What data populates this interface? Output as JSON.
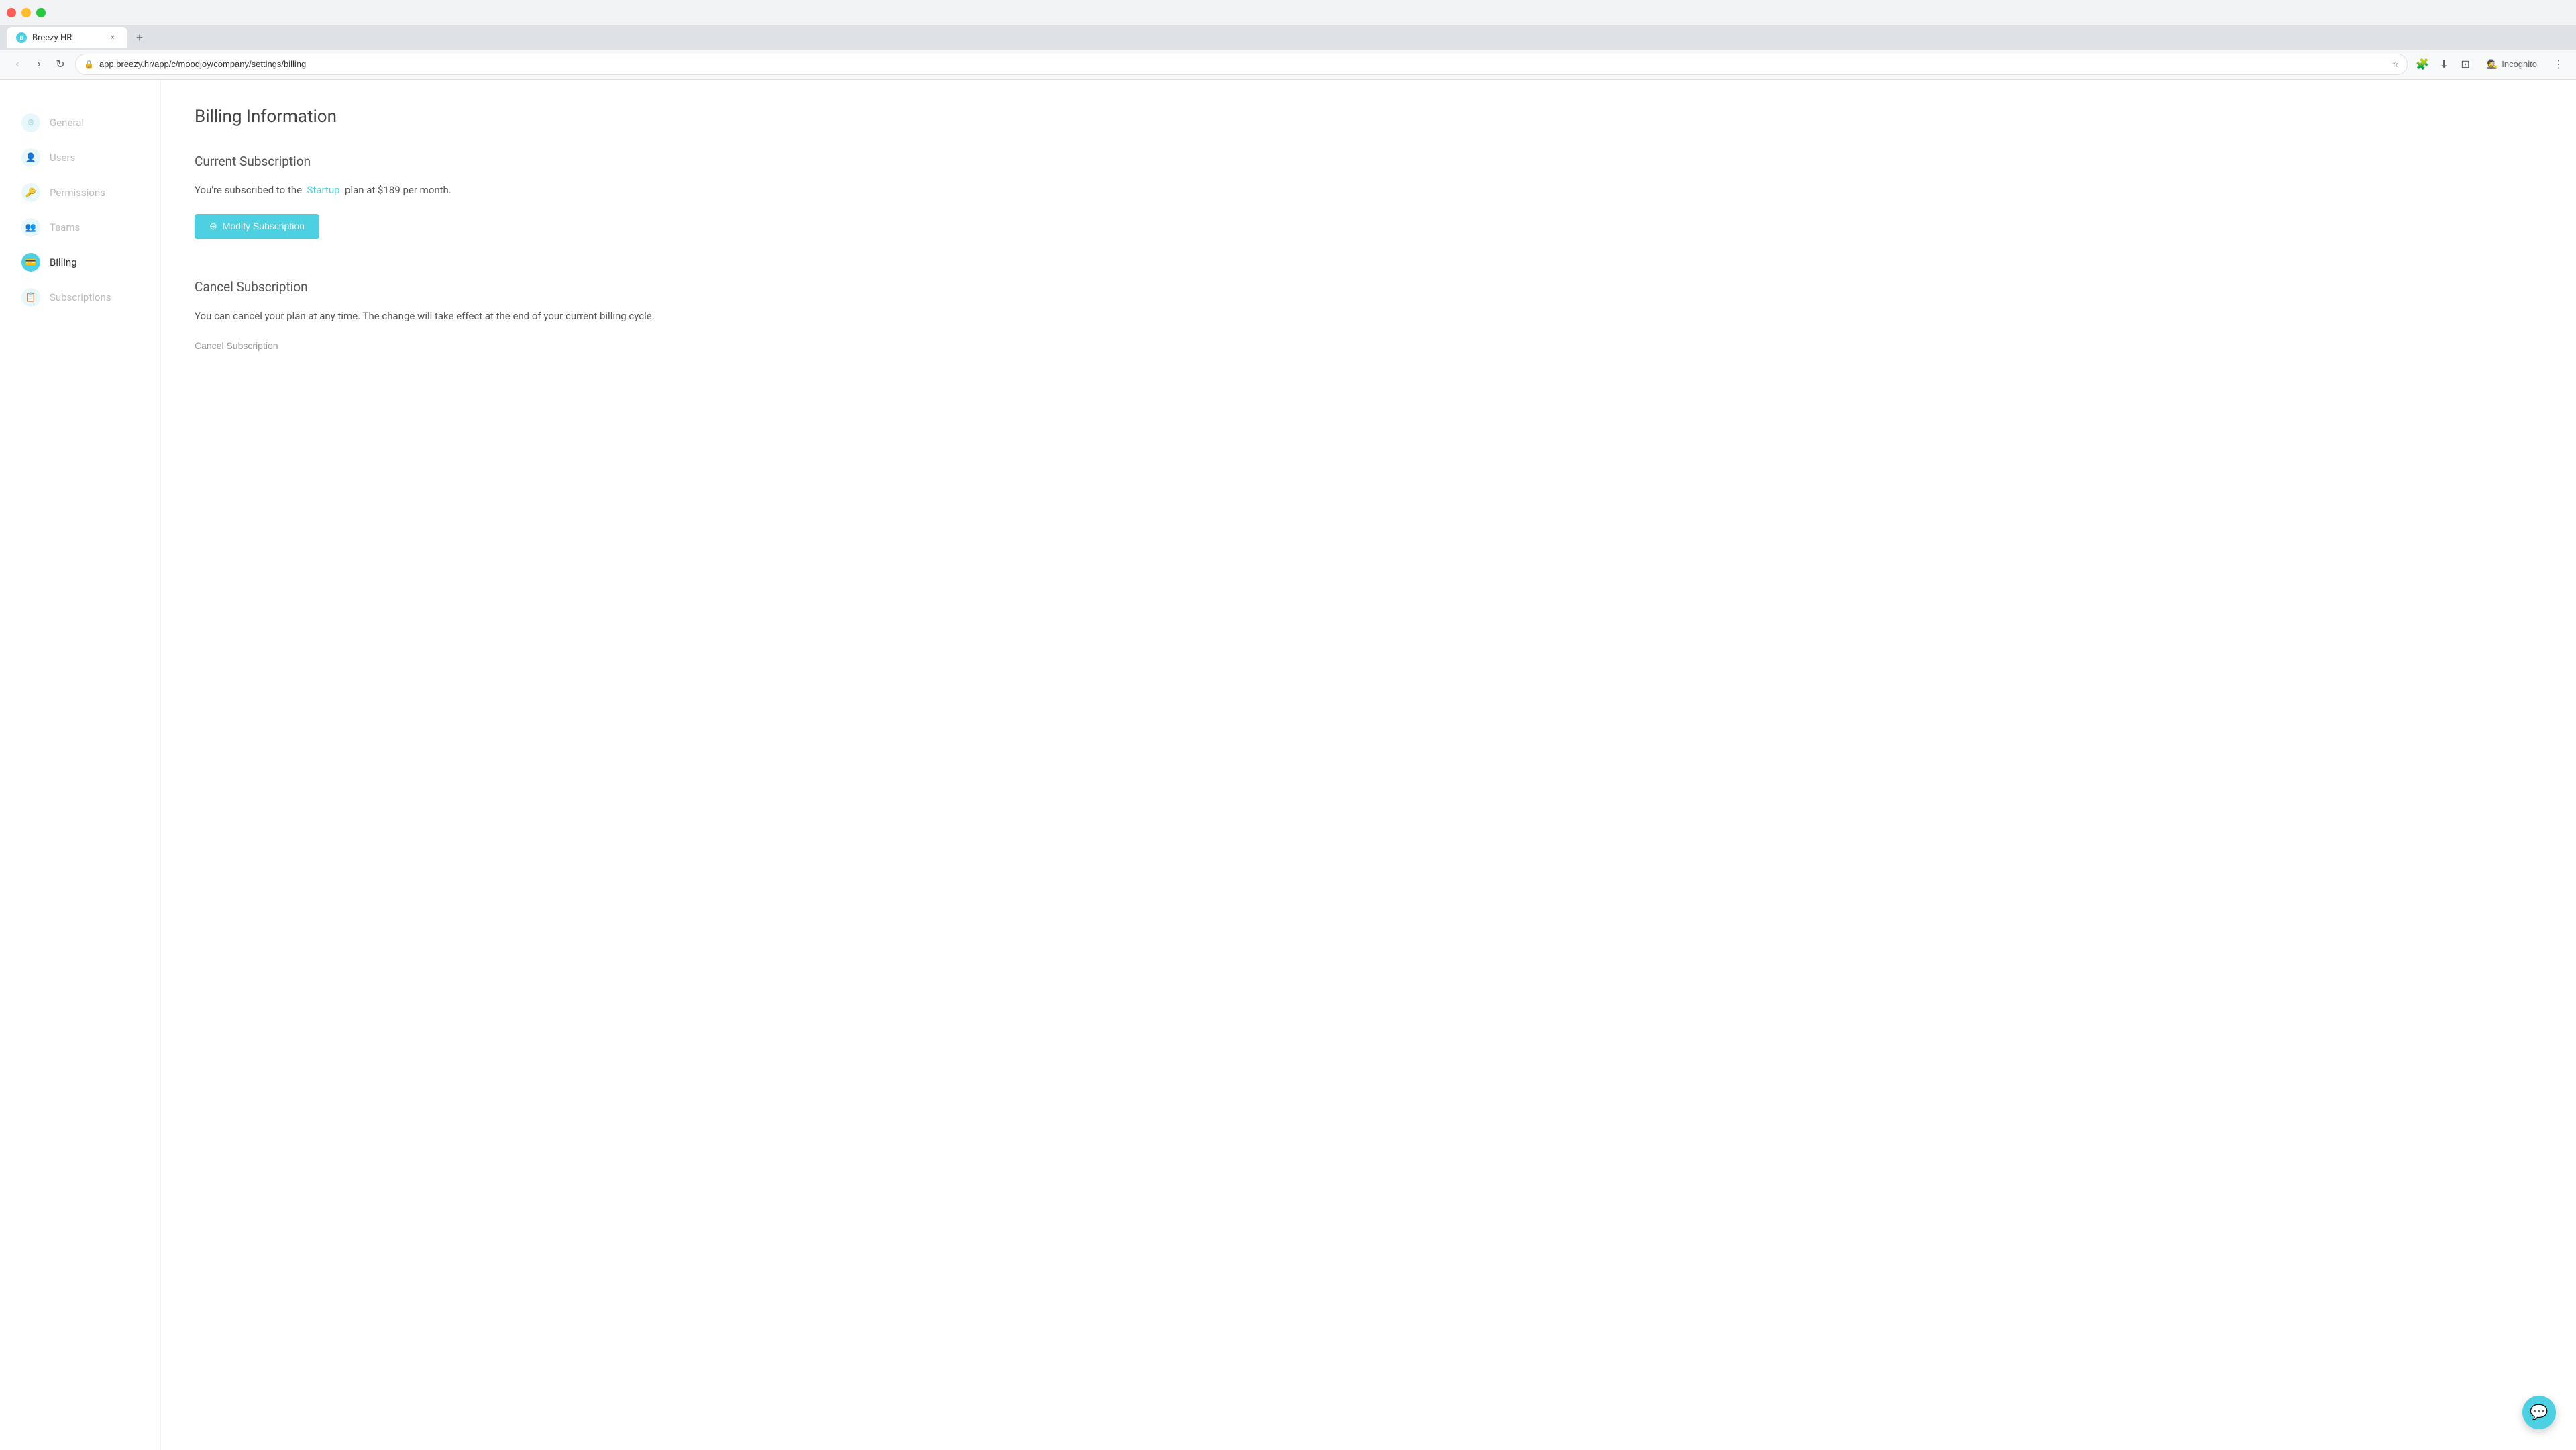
{
  "browser": {
    "tab_title": "Breezy HR",
    "url": "app.breezy.hr/app/c/moodjoy/company/settings/billing",
    "incognito_label": "Incognito"
  },
  "sidebar": {
    "items": [
      {
        "id": "general",
        "label": "General",
        "active": false
      },
      {
        "id": "users",
        "label": "Users",
        "active": false
      },
      {
        "id": "permissions",
        "label": "Permissions",
        "active": false
      },
      {
        "id": "teams",
        "label": "Teams",
        "active": false
      },
      {
        "id": "billing",
        "label": "Billing",
        "active": true
      },
      {
        "id": "subscriptions",
        "label": "Subscriptions",
        "active": false
      }
    ]
  },
  "main": {
    "page_title": "Billing Information",
    "current_subscription": {
      "section_title": "Current Subscription",
      "description_prefix": "You're subscribed to the",
      "plan_link": "Startup",
      "description_suffix": "plan at $189 per month.",
      "modify_button": "Modify Subscription"
    },
    "cancel_subscription": {
      "section_title": "Cancel Subscription",
      "description": "You can cancel your plan at any time. The change will take effect at the end of your current billing cycle.",
      "cancel_button": "Cancel Subscription"
    }
  },
  "chat_widget": {
    "icon": "💬"
  }
}
